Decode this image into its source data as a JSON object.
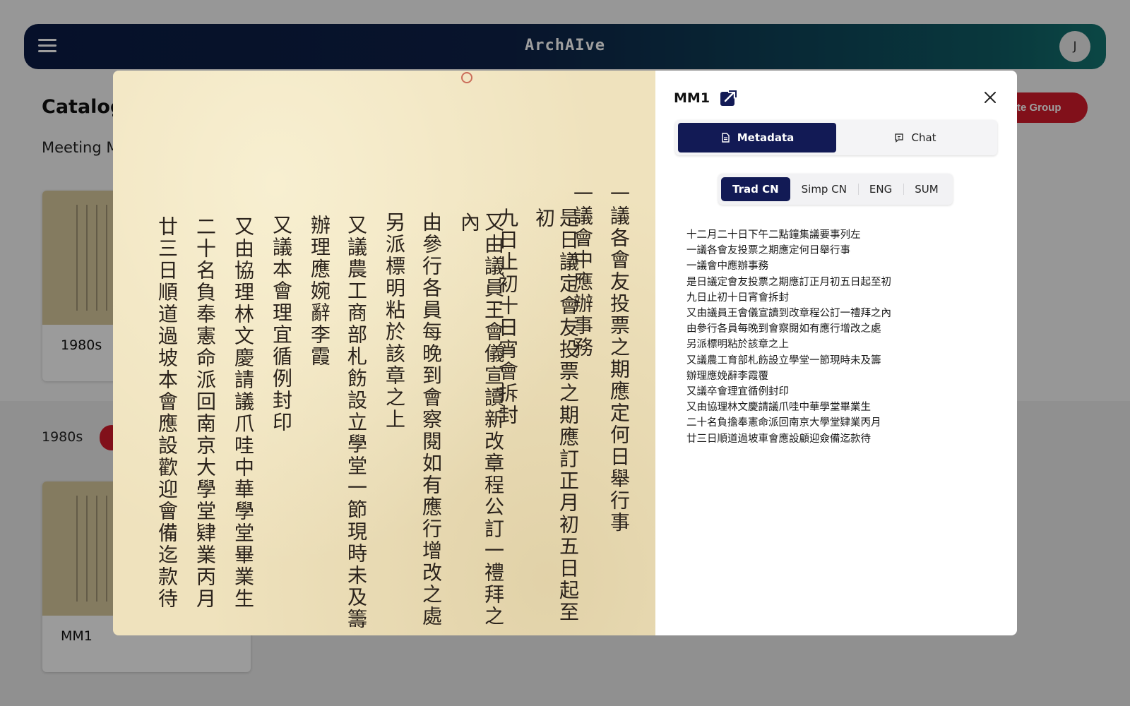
{
  "navbar": {
    "title": "ArchAIve",
    "avatar_initial": "J",
    "menu_icon": "hamburger-icon"
  },
  "page": {
    "title": "Catalog",
    "subtitle": "Meeting M",
    "create_group_label": "reate Group"
  },
  "section": {
    "label": "1980s"
  },
  "cards": [
    {
      "label": "1980s"
    },
    {
      "label": "MM1"
    }
  ],
  "modal": {
    "title": "MM1",
    "open_icon": "external-link-icon",
    "close_icon": "close-icon",
    "tabs": [
      {
        "label": "Metadata",
        "icon": "document-icon",
        "active": true
      },
      {
        "label": "Chat",
        "icon": "chat-bubble-icon",
        "active": false
      }
    ],
    "languages": [
      {
        "label": "Trad CN",
        "active": true
      },
      {
        "label": "Simp CN",
        "active": false
      },
      {
        "label": "ENG",
        "active": false
      },
      {
        "label": "SUM",
        "active": false
      }
    ],
    "transcription": [
      "十二月二十日下午二點鐘集議要事列左",
      "一議各會友投票之期應定何日舉行事",
      "一議會中應辦事務",
      "是日議定會友投票之期應訂正月初五日起至初",
      "九日止初十日宵會拆封",
      "又由議員王會儀宣讀到改章程公訂一禮拜之內",
      "由參行各員每晚到會察閱如有應行增改之處",
      "另派標明粘於該章之上",
      "又議農工育部札飭設立學堂一節現時未及籌",
      "辦理應娩辭李霞覆",
      "又議卒會理宜循例封印",
      "又由協理林文慶請議爪哇中華學堂畢業生",
      "二十名負擔奉憲命派回南京大學堂肄業丙月",
      "廿三日順道過坡車會應設顧迎僉備迄款待"
    ],
    "manuscript_columns": [
      "一議各會友投票之期應定何日舉行事",
      "一議會中應辦事務",
      "是日議定會友投票之期應訂正月初五日起至初",
      "九日止初十日宵會拆封",
      "又由議員王會儀宣讀新改章程公訂一禮拜之內",
      "由參行各員每晚到會察閱如有應行增改之處",
      "另派標明粘於該章之上",
      "又議農工商部札飭設立學堂一節現時未及籌",
      "辦理應婉辭李霞",
      "又議本會理宜循例封印",
      "又由協理林文慶請議爪哇中華學堂畢業生",
      "二十名負奉憲命派回南京大學堂肄業丙月",
      "廿三日順道過坡本會應設歡迎會備迄款待"
    ]
  }
}
